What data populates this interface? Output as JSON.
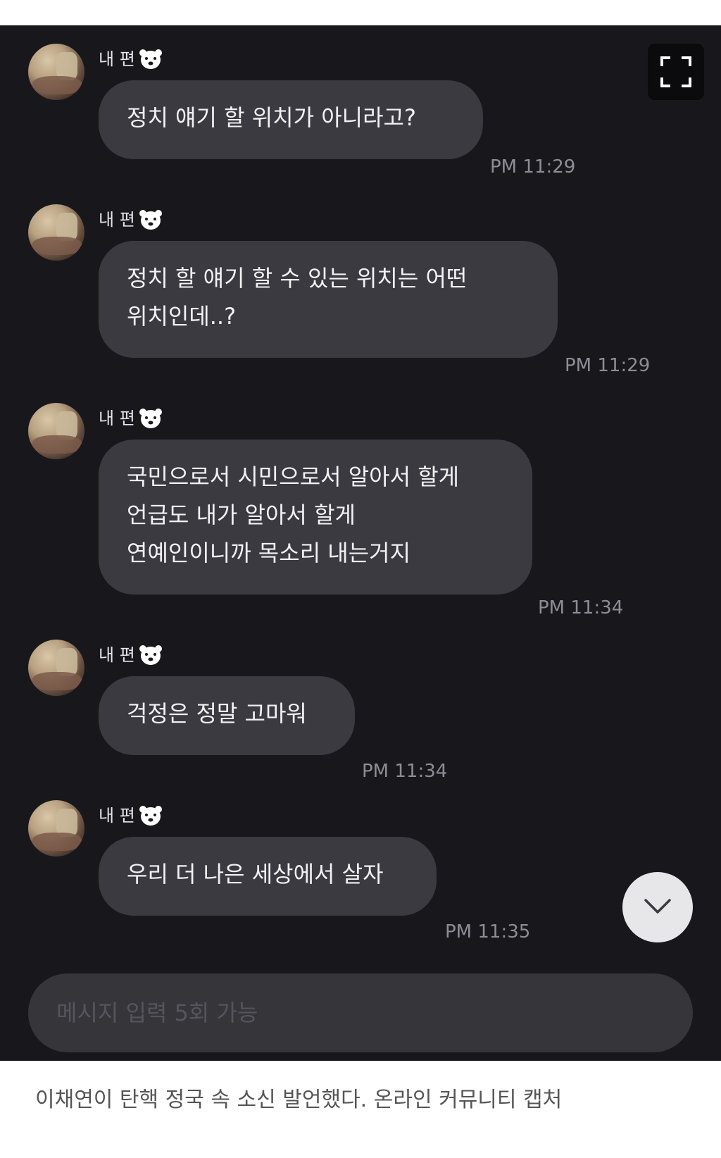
{
  "chat": {
    "messages": [
      {
        "sender": "내 편",
        "text": "정치 얘기 할 위치가 아니라고?",
        "time": "PM 11:29"
      },
      {
        "sender": "내 편",
        "text": "정치 할 얘기 할 수 있는 위치는 어떤\n위치인데..?",
        "time": "PM 11:29"
      },
      {
        "sender": "내 편",
        "text": "국민으로서 시민으로서 알아서 할게\n언급도 내가 알아서 할게\n연예인이니까 목소리 내는거지",
        "time": "PM 11:34"
      },
      {
        "sender": "내 편",
        "text": "걱정은 정말 고마워",
        "time": "PM 11:34"
      },
      {
        "sender": "내 편",
        "text": "우리 더 나은 세상에서 살자",
        "time": "PM 11:35"
      }
    ],
    "input": {
      "placeholder": "메시지 입력 5회 가능"
    },
    "colors": {
      "background": "#18181c",
      "bubble": "#3a3a40",
      "time": "#8d8d93"
    },
    "icons": [
      "fullscreen-icon",
      "chevron-down-icon",
      "polar-bear-icon"
    ]
  },
  "caption": "이채연이 탄핵 정국 속 소신 발언했다. 온라인 커뮤니티 캡처"
}
